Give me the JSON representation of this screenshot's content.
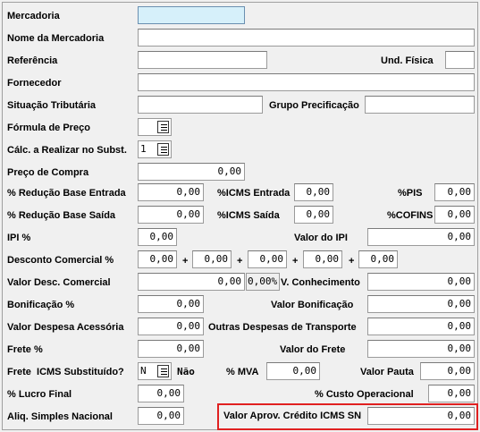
{
  "fields": {
    "mercadoria": {
      "label": "Mercadoria",
      "value": ""
    },
    "nome_mercadoria": {
      "label": "Nome da Mercadoria",
      "value": ""
    },
    "referencia": {
      "label": "Referência",
      "value": ""
    },
    "und_fisica": {
      "label": "Und. Física",
      "value": ""
    },
    "fornecedor": {
      "label": "Fornecedor",
      "value": ""
    },
    "situacao_tributaria": {
      "label": "Situação Tributária",
      "value": ""
    },
    "grupo_precificacao": {
      "label": "Grupo Precificação",
      "value": ""
    },
    "formula_preco": {
      "label": "Fórmula de Preço",
      "value": ""
    },
    "calc_realizar_subst": {
      "label": "Cálc. a Realizar no Subst.",
      "value": "1"
    },
    "preco_compra": {
      "label": "Preço de Compra",
      "value": "0,00"
    },
    "reducao_base_entrada": {
      "label": "% Redução Base Entrada",
      "value": "0,00"
    },
    "icms_entrada": {
      "label": "%ICMS Entrada",
      "value": "0,00"
    },
    "pis": {
      "label": "%PIS",
      "value": "0,00"
    },
    "reducao_base_saida": {
      "label": "% Redução Base Saída",
      "value": "0,00"
    },
    "icms_saida": {
      "label": "%ICMS Saída",
      "value": "0,00"
    },
    "cofins": {
      "label": "%COFINS",
      "value": "0,00"
    },
    "ipi": {
      "label": "IPI %",
      "value": "0,00"
    },
    "valor_ipi": {
      "label": "Valor do IPI",
      "value": "0,00"
    },
    "desconto_comercial": {
      "label": "Desconto Comercial %",
      "values": [
        "0,00",
        "0,00",
        "0,00",
        "0,00",
        "0,00"
      ],
      "plus": "+"
    },
    "valor_desc_comercial": {
      "label": "Valor Desc. Comercial",
      "value": "0,00",
      "pct": "0,00%"
    },
    "v_conhecimento": {
      "label": "V. Conhecimento",
      "value": "0,00"
    },
    "bonificacao_pct": {
      "label": "Bonificação %",
      "value": "0,00"
    },
    "valor_bonificacao": {
      "label": "Valor Bonificação",
      "value": "0,00"
    },
    "valor_despesa_acessoria": {
      "label": "Valor Despesa Acessória",
      "value": "0,00"
    },
    "outras_despesas_transporte": {
      "label": "Outras Despesas de Transporte",
      "value": "0,00"
    },
    "frete_pct": {
      "label": "Frete %",
      "value": "0,00"
    },
    "valor_frete": {
      "label": "Valor do Frete",
      "value": "0,00"
    },
    "frete_icms_substituido": {
      "label": "Frete  ICMS Substituído?",
      "value": "N",
      "hint": "Não"
    },
    "mva": {
      "label": "% MVA",
      "value": "0,00"
    },
    "valor_pauta": {
      "label": "Valor Pauta",
      "value": "0,00"
    },
    "lucro_final": {
      "label": "% Lucro Final",
      "value": "0,00"
    },
    "custo_operacional": {
      "label": "% Custo Operacional",
      "value": "0,00"
    },
    "aliq_simples_nacional": {
      "label": "Aliq. Simples Nacional",
      "value": "0,00"
    },
    "valor_aprov_credito_icms_sn": {
      "label": "Valor Aprov. Crédito ICMS SN",
      "value": "0,00"
    }
  },
  "highlight_color": "#e02020"
}
